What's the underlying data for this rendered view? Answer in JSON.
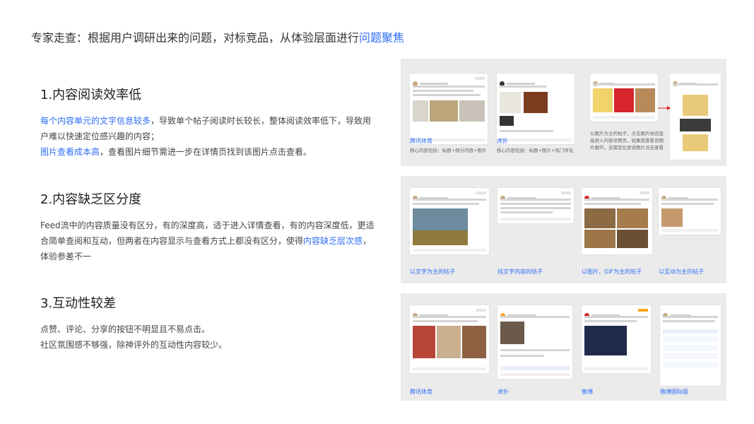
{
  "header": {
    "prefix": "专家走查：根据用户调研出来的问题，对标竞品，从体验层面进行",
    "highlight": "问题聚焦"
  },
  "sections": [
    {
      "title": "1.内容阅读效率低",
      "p1_hl": "每个内容单元的文字信息较多",
      "p1_rest": "，导致单个帖子阅读时长较长，整体阅读效率低下，导致用户难以快速定位感兴趣的内容；",
      "p2_hl": "图片查看成本高",
      "p2_rest": "，查看图片细节需进一步在详情页找到该图片点击查看。"
    },
    {
      "title": "2.内容缺乏区分度",
      "p1_a": "Feed流中的内容质量没有区分，有的深度高，适于进入详情查看，有的内容深度低，更适合简单查阅和互动，但两者在内容显示与查看方式上都没有区分，使得",
      "p1_hl": "内容缺乏层次感",
      "p1_b": "，体验参差不一"
    },
    {
      "title": "3.互动性较差",
      "line1": "点赞、评论、分享的按钮不明显且不易点击。",
      "line2": "社区氛围感不够强，除神评外的互动性内容较少。"
    }
  ],
  "panels": [
    {
      "captions": [
        "腾讯体育",
        "虎扑"
      ],
      "subs": [
        "核心内容包括：标题+部分内容+图片",
        "核心内容包括：标题+图片+热门评论"
      ],
      "note": "以图片为主的帖子，点击图片依旧直接进入内容详情页，如果想查看该图片细节，还需定位至该图片点击查看"
    },
    {
      "captions": [
        "以文字为主的帖子",
        "纯文字内容的帖子",
        "以图片、GIF为主的帖子",
        "以互动为主的帖子"
      ]
    },
    {
      "captions": [
        "腾讯体育",
        "虎扑",
        "微博",
        "微博国际版"
      ]
    }
  ]
}
